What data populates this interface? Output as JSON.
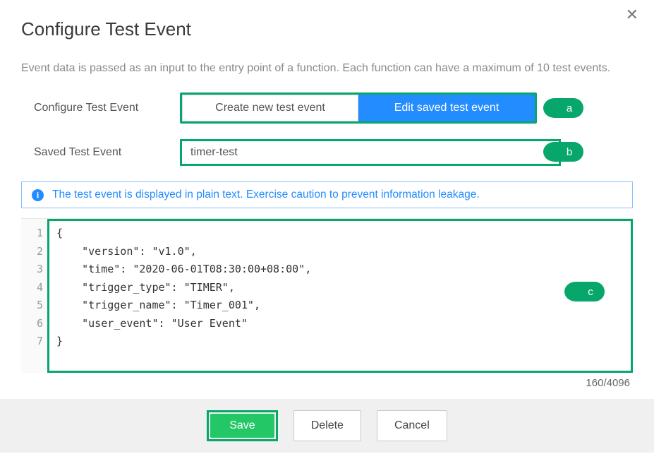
{
  "modal": {
    "closeIcon": "✕",
    "title": "Configure Test Event",
    "description": "Event data is passed as an input to the entry point of a function. Each function can have a maximum of 10 test events."
  },
  "configRow": {
    "label": "Configure Test Event",
    "createBtn": "Create new test event",
    "editBtn": "Edit saved test event"
  },
  "savedRow": {
    "label": "Saved Test Event",
    "selected": "timer-test"
  },
  "info": {
    "text": "The test event is displayed in plain text. Exercise caution to prevent information leakage."
  },
  "editor": {
    "lineNumbers": [
      "1",
      "2",
      "3",
      "4",
      "5",
      "6",
      "7"
    ],
    "payload": {
      "version": "v1.0",
      "time": "2020-06-01T08:30:00+08:00",
      "trigger_type": "TIMER",
      "trigger_name": "Timer_001",
      "user_event": "User Event"
    },
    "lines": [
      "{",
      "    \"version\": \"v1.0\",",
      "    \"time\": \"2020-06-01T08:30:00+08:00\",",
      "    \"trigger_type\": \"TIMER\",",
      "    \"trigger_name\": \"Timer_001\",",
      "    \"user_event\": \"User Event\"",
      "}"
    ],
    "counter": "160/4096"
  },
  "footer": {
    "save": "Save",
    "delete": "Delete",
    "cancel": "Cancel"
  },
  "callouts": {
    "a": "a",
    "b": "b",
    "c": "c"
  }
}
